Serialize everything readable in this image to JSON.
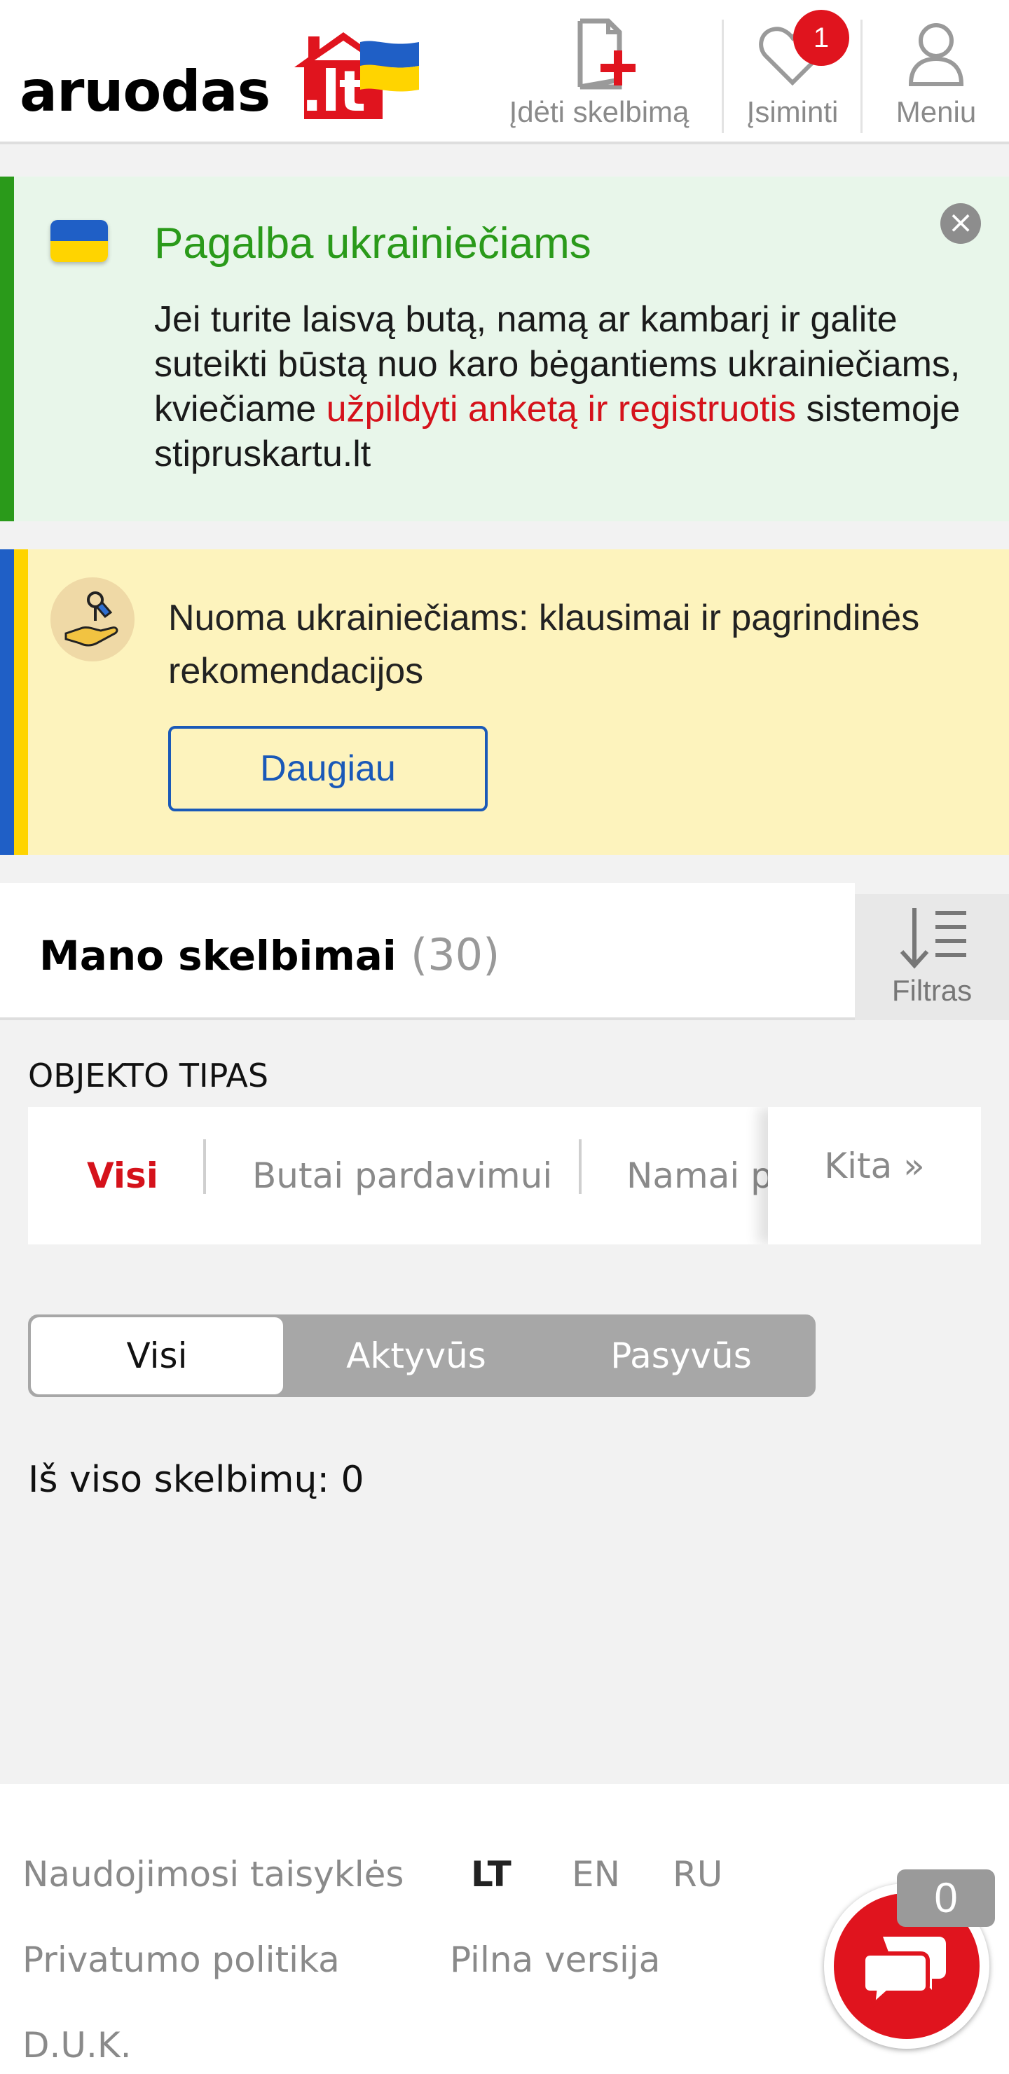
{
  "header": {
    "logo_text": "aruodas",
    "logo_suffix": ".lt",
    "post_ad_label": "Įdėti skelbimą",
    "favorites_label": "Įsiminti",
    "favorites_count": "1",
    "menu_label": "Meniu"
  },
  "ukraine_banner": {
    "title": "Pagalba ukrainiečiams",
    "text_before": "Jei turite laisvą butą, namą ar kambarį ir galite suteikti būstą nuo karo bėgantiems ukrainiečiams, kviečiame ",
    "link_text": "užpildyti anketą ir registruotis",
    "text_after": " sistemoje stipruskartu.lt",
    "close_symbol": "×"
  },
  "rent_banner": {
    "text": "Nuoma ukrainiečiams: klausimai ir pagrindinės rekomendacijos",
    "button_label": "Daugiau"
  },
  "my_ads": {
    "title": "Mano skelbimai",
    "count": "(30)",
    "filter_label": "Filtras"
  },
  "object_type": {
    "label": "OBJEKTO TIPAS",
    "tabs": [
      "Visi",
      "Butai pardavimui",
      "Namai pardavimui"
    ],
    "more_label": "Kita »"
  },
  "status_filter": {
    "options": [
      "Visi",
      "Aktyvūs",
      "Pasyvūs"
    ],
    "selected": "Visi"
  },
  "total_text": "Iš viso skelbimų: 0",
  "footer": {
    "terms": "Naudojimosi taisyklės",
    "privacy": "Privatumo politika",
    "faq": "D.U.K.",
    "full_version": "Pilna versija",
    "languages": [
      "LT",
      "EN",
      "RU"
    ],
    "active_language": "LT"
  },
  "chat": {
    "count": "0"
  },
  "colors": {
    "brand_red": "#e0141e",
    "green": "#2a9a1a",
    "blue": "#1a59b8",
    "ukraine_blue": "#1f5fc6",
    "ukraine_yellow": "#ffd400"
  }
}
